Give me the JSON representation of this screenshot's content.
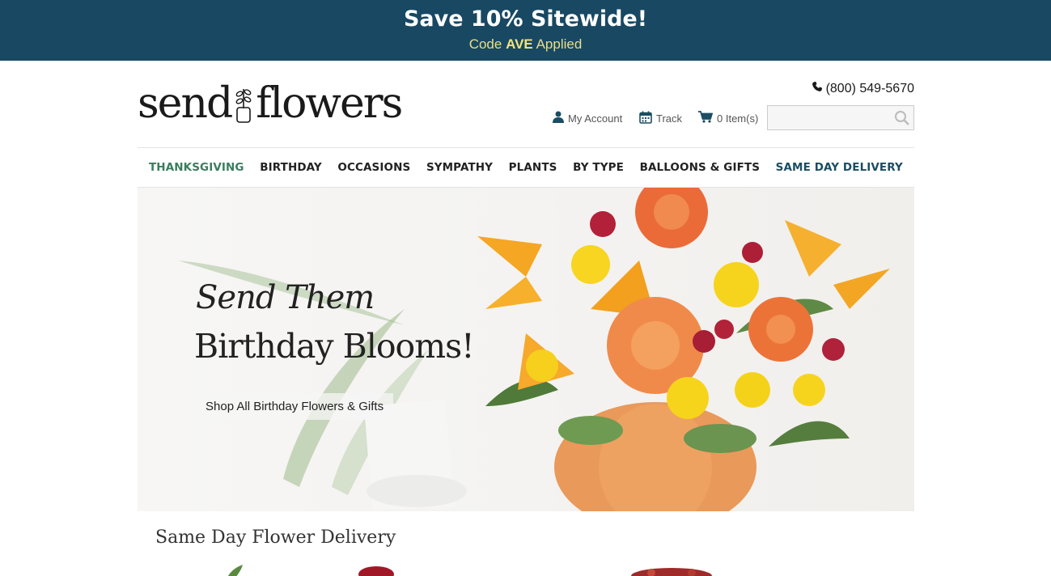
{
  "promo": {
    "title": "Save 10% Sitewide!",
    "code_prefix": "Code",
    "code": "AVE",
    "code_suffix": "Applied"
  },
  "header": {
    "logo_part1": "send",
    "logo_part2": "flowers",
    "phone": "(800) 549-5670",
    "account_label": "My Account",
    "track_label": "Track",
    "cart_label": "0 Item(s)",
    "search_placeholder": ""
  },
  "nav": {
    "items": [
      "THANKSGIVING",
      "BIRTHDAY",
      "OCCASIONS",
      "SYMPATHY",
      "PLANTS",
      "BY TYPE",
      "BALLOONS & GIFTS",
      "SAME DAY DELIVERY"
    ]
  },
  "hero": {
    "line1": "Send Them",
    "line2": "Birthday Blooms!",
    "cta": "Shop All Birthday Flowers & Gifts"
  },
  "section": {
    "title": "Same Day Flower Delivery"
  },
  "colors": {
    "promo_bg": "#184862",
    "promo_code": "#e9df86",
    "nav_green": "#3a7d5e",
    "nav_teal": "#1b4d63"
  }
}
